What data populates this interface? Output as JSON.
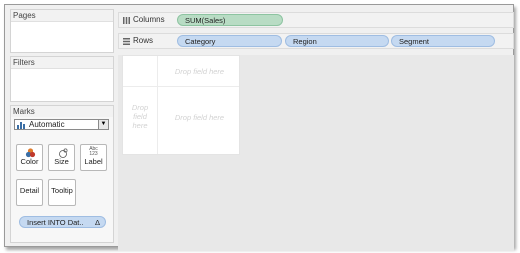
{
  "panels": {
    "pages_title": "Pages",
    "filters_title": "Filters",
    "marks_title": "Marks"
  },
  "marks": {
    "mark_type": "Automatic",
    "buttons": {
      "color": "Color",
      "size": "Size",
      "label": "Label",
      "label_icon_text": "Abc\n123",
      "detail": "Detail",
      "tooltip": "Tooltip"
    },
    "field_pill": "Insert INTO Dat..",
    "field_pill_symbol": "Δ"
  },
  "shelves": {
    "columns_label": "Columns",
    "rows_label": "Rows",
    "columns_pills": [
      "SUM(Sales)"
    ],
    "rows_pills": [
      "Category",
      "Region",
      "Segment"
    ]
  },
  "viz": {
    "drop_hint_top": "Drop field here",
    "drop_hint_left": "Drop\nfield\nhere",
    "drop_hint_center": "Drop field here"
  },
  "colors": {
    "dimension_pill": "#c5d9f1",
    "measure_pill": "#b8dcc4",
    "accent_blue": "#3a6ea5"
  }
}
